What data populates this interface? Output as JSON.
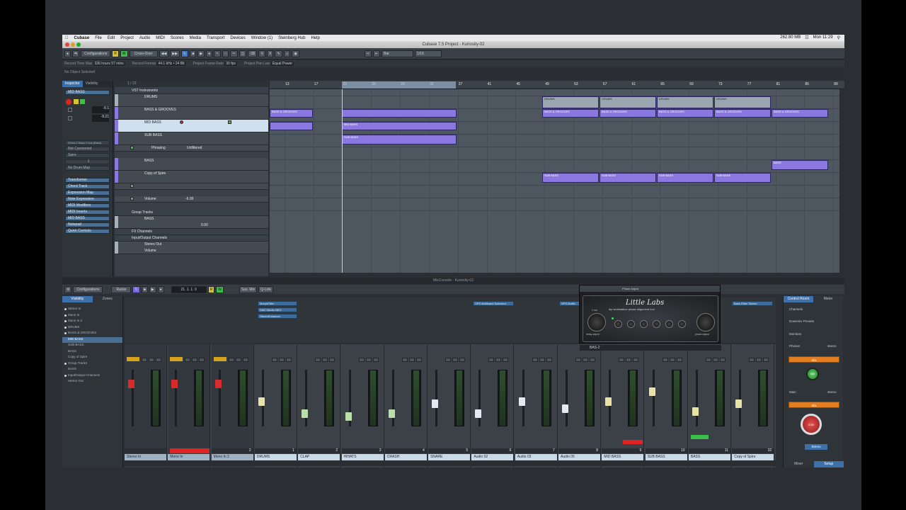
{
  "menubar": {
    "items": [
      "Cubase",
      "File",
      "Edit",
      "Project",
      "Audio",
      "MIDI",
      "Scores",
      "Media",
      "Transport",
      "Devices",
      "Window (1)",
      "Steinberg Hub",
      "Help"
    ],
    "status": [
      "262.80 MB",
      "Mon 11:29"
    ]
  },
  "window": {
    "title": "Cubase 7.5 Project - Kuriosity-02"
  },
  "toolbar": {
    "configurations_label": "Configurations",
    "crossover_label": "Cross-Over",
    "grid_label": "Bar",
    "quantize_label": "1/16"
  },
  "infobar": [
    {
      "label": "Record Time Max",
      "value": "336 hours 57 mins"
    },
    {
      "label": "Record Format",
      "value": "44.1 kHz • 24 Bit"
    },
    {
      "label": "Project Frame Rate",
      "value": "30 fps"
    },
    {
      "label": "Project Pan Law",
      "value": "Equal Power"
    }
  ],
  "status_line": "No Object Selected",
  "inspector": {
    "tabs": [
      "Inspector",
      "Visibility"
    ],
    "track_name": "MID BASS",
    "values": [
      "-9.1",
      "-9.21"
    ],
    "io": [
      "Zebra 2 Bass 2 bus (Bass)",
      "Not Connected",
      "Spire"
    ],
    "chain": "1",
    "drum_map": "No Drum Map",
    "sections": [
      "Expression Map",
      "Note Expression",
      "Quick Controls",
      "MIDI Inserts",
      "MIDI Modifiers",
      "MIDI Fader",
      "Notepad",
      "Quick Controls"
    ],
    "sections_visible": [
      "Transformer",
      "Chord Track",
      "Expression Map",
      "Note Expression",
      "MIDI Modifiers",
      "MIDI Inserts",
      "MID BASS",
      "Notepad",
      "Quick Controls"
    ]
  },
  "tracklist": {
    "header": "1 / 23",
    "tracks": [
      {
        "name": "VST Instruments"
      },
      {
        "name": "DRUMS"
      },
      {
        "name": "BASS & GROOVES"
      },
      {
        "name": "MID BASS"
      },
      {
        "name": "SUB BASS"
      },
      {
        "name": "Phrasing",
        "sub": "Unfiltered"
      },
      {
        "name": "BASS"
      },
      {
        "name": "Copy of Spire"
      },
      {
        "name": "Volume",
        "value": "-6.00"
      },
      {
        "name": "Group Tracks"
      },
      {
        "name": "BASS"
      },
      {
        "name": "Volume",
        "value": "0.00"
      },
      {
        "name": "FX Channels"
      },
      {
        "name": "Input/Output Channels"
      },
      {
        "name": "Stereo Out"
      },
      {
        "name": "Volume",
        "value": "0.00"
      }
    ]
  },
  "ruler": [
    "13",
    "17",
    "21",
    "25",
    "29",
    "33",
    "37",
    "41",
    "45",
    "49",
    "53",
    "57",
    "61",
    "65",
    "69",
    "73",
    "77",
    "81",
    "85",
    "89"
  ],
  "arrange": {
    "event_labels": {
      "drums": "DRUMS",
      "bass_grooves": "BASS & GROOVES",
      "mid": "MID BASS",
      "sub": "SUB BASS",
      "bass": "BASS"
    }
  },
  "mixconsole": {
    "title": "MixConsole - Kuriosity-02",
    "toolbar": [
      "Configurations",
      "Racks",
      "Sus. Mix",
      "Q-Link"
    ],
    "counter": "21. 1. 1. 0",
    "visibility_tabs": [
      "Visibility",
      "Zones"
    ],
    "visibility_items": [
      "Stereo In",
      "Mono In",
      "Mono In 2",
      "DRUMS",
      "BASS & GROOVES",
      "MID BASS",
      "SUB BASS",
      "BASS",
      "Copy of Spire",
      "Group Tracks",
      "BASS",
      "Input/Output Channels",
      "Stereo Out"
    ],
    "inserts": [
      "MorphFilter",
      "SAD Studio NEO",
      "StereoEnhancer",
      "SPS Multiband Saturator",
      "SPS Multib",
      "Bass Rider Stereo"
    ],
    "channels": [
      {
        "name": "Stereo In",
        "num": ""
      },
      {
        "name": "Mono In",
        "num": "1"
      },
      {
        "name": "Mono In 2",
        "num": "2"
      },
      {
        "name": "DRUMS",
        "num": "1"
      },
      {
        "name": "CLAP",
        "num": "2"
      },
      {
        "name": "HIHATS",
        "num": "3"
      },
      {
        "name": "CRASH",
        "num": "4"
      },
      {
        "name": "SNARE",
        "num": "5"
      },
      {
        "name": "Audio 02",
        "num": "6"
      },
      {
        "name": "Audio 03",
        "num": "7"
      },
      {
        "name": "Audio 05",
        "num": "8"
      },
      {
        "name": "MID BASS",
        "num": "9"
      },
      {
        "name": "SUB BASS",
        "num": "10"
      },
      {
        "name": "BASS",
        "num": "11"
      },
      {
        "name": "Copy of Spire",
        "num": "32"
      }
    ]
  },
  "plugin": {
    "title": "Phase Adjust",
    "name": "Little Labs",
    "subtitle": "ibp workstation phase alignment tool",
    "slot": "BAS-2",
    "knob_labels": [
      "delay adjust",
      "power",
      "phase adj bypass",
      "phase invert",
      "phase adj 180",
      "phase center",
      "phase adjust"
    ],
    "scale": "2 ms"
  },
  "control_room": {
    "tabs": [
      "Control Room",
      "Meter"
    ],
    "labels": [
      "Channels",
      "Downmix Presets",
      "Monitors",
      "Phones",
      "Main"
    ],
    "phones_format": "stereo",
    "main_format": "stereo",
    "mix_label": "Mix",
    "phones_level": "0.00",
    "main_level": "0.00",
    "main_button": "Stereo",
    "bottom_tabs": [
      "Mixer",
      "Setup"
    ]
  }
}
